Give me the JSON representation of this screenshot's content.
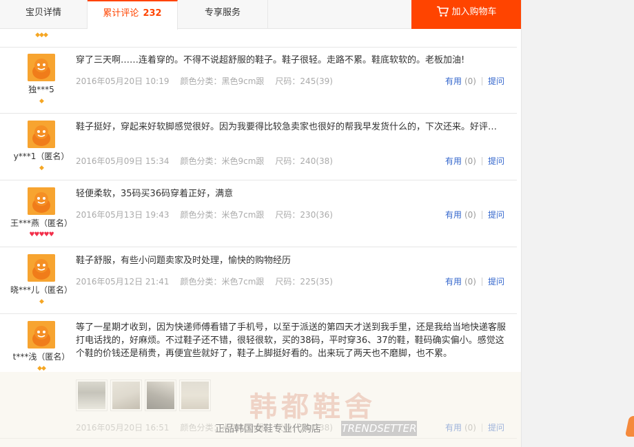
{
  "tabs": [
    {
      "label": "宝贝详情"
    },
    {
      "label": "累计评论",
      "count": "232"
    },
    {
      "label": "专享服务"
    }
  ],
  "cart": {
    "label": "加入购物车"
  },
  "actions": {
    "useful_label": "有用",
    "ask_label": "提问"
  },
  "top_partial": {
    "rank": "◆◆◆"
  },
  "reviews": [
    {
      "user": "独***5",
      "rank": "◆",
      "content": "穿了三天啊……连着穿的。不得不说超舒服的鞋子。鞋子很轻。走路不累。鞋底软软的。老板加油!",
      "date": "2016年05月20日 10:19",
      "color": "颜色分类：黑色9cm跟",
      "size": "尺码：245(39)",
      "useful_count": "(0)"
    },
    {
      "user": "y***1（匿名）",
      "rank": "◆",
      "content": "鞋子挺好，穿起来好软脚感觉很好。因为我要得比较急卖家也很好的帮我早发货什么的，下次还来。好评…",
      "date": "2016年05月09日 15:34",
      "color": "颜色分类：米色9cm跟",
      "size": "尺码：240(38)",
      "useful_count": "(0)"
    },
    {
      "user": "王***燕（匿名）",
      "rank": "♥♥♥♥♥",
      "content": "轻便柔软，35码买36码穿着正好，满意",
      "date": "2016年05月13日 19:43",
      "color": "颜色分类：米色7cm跟",
      "size": "尺码：230(36)",
      "useful_count": "(0)"
    },
    {
      "user": "晓***儿（匿名）",
      "rank": "◆",
      "content": "鞋子舒服，有些小问题卖家及时处理，愉快的购物经历",
      "date": "2016年05月12日 21:41",
      "color": "颜色分类：米色7cm跟",
      "size": "尺码：225(35)",
      "useful_count": "(0)"
    },
    {
      "user": "t***浅（匿名）",
      "rank": "◆◆",
      "content": "等了一星期才收到，因为快递师傅看错了手机号，以至于派送的第四天才送到我手里，还是我给当地快递客服打电话找的，好麻烦。不过鞋子还不错，很轻很软，买的38码，平时穿36、37的鞋，鞋码确实偏小。感觉这个鞋的价钱还是稍贵，再便宜些就好了，鞋子上脚挺好看的。出来玩了两天也不磨脚，也不累。",
      "date": "2016年05月20日 16:51",
      "color": "颜色分类：米色7cm跟",
      "size": "尺码：240(38)",
      "useful_count": "(0)"
    }
  ],
  "watermark": {
    "title": "韩都鞋舍",
    "subtitle": "正品韩国女鞋专业代购店",
    "badge": "TRENDSETTER"
  }
}
